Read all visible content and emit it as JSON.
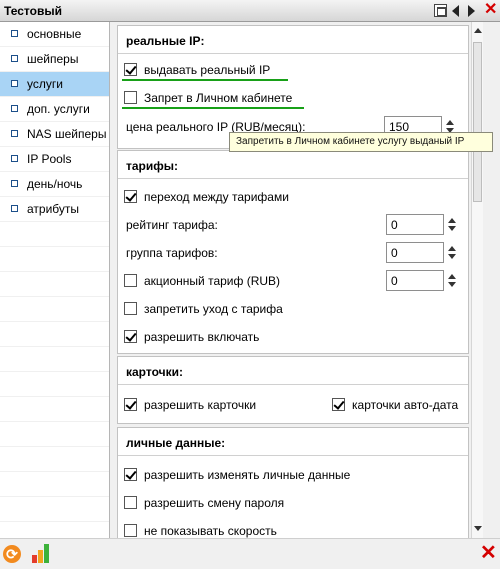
{
  "window": {
    "title": "Тестовый"
  },
  "sidebar": {
    "items": [
      {
        "label": "основные"
      },
      {
        "label": "шейперы"
      },
      {
        "label": "услуги"
      },
      {
        "label": "доп. услуги"
      },
      {
        "label": "NAS шейперы"
      },
      {
        "label": "IP Pools"
      },
      {
        "label": "день/ночь"
      },
      {
        "label": "атрибуты"
      }
    ],
    "active_index": 2
  },
  "sections": {
    "real_ip": {
      "title": "реальные IP:",
      "give_real_ip": {
        "label": "выдавать реальный IP",
        "checked": true
      },
      "deny_in_cabinet": {
        "label": "Запрет в Личном кабинете",
        "checked": false
      },
      "price": {
        "label": "цена реального IP (RUB/месяц):",
        "value": "150"
      }
    },
    "tariffs": {
      "title": "тарифы:",
      "switch_between": {
        "label": "переход между тарифами",
        "checked": true
      },
      "rating": {
        "label": "рейтинг тарифа:",
        "value": "0"
      },
      "group": {
        "label": "группа тарифов:",
        "value": "0"
      },
      "promo": {
        "label": "акционный тариф (RUB)",
        "checked": false,
        "value": "0"
      },
      "deny_leave": {
        "label": "запретить уход с тарифа",
        "checked": false
      },
      "allow_enable": {
        "label": "разрешить включать",
        "checked": true
      }
    },
    "cards": {
      "title": "карточки:",
      "allow_cards": {
        "label": "разрешить карточки",
        "checked": true
      },
      "cards_auto_date": {
        "label": "карточки авто-дата",
        "checked": true
      }
    },
    "personal": {
      "title": "личные данные:",
      "allow_edit": {
        "label": "разрешить изменять личные данные",
        "checked": true
      },
      "allow_password": {
        "label": "разрешить смену пароля",
        "checked": false
      },
      "hide_speed": {
        "label": "не показывать скорость",
        "checked": false
      }
    }
  },
  "tooltip": {
    "text": "Запретить в Личном кабинете услугу выданый IP"
  },
  "colors": {
    "active_item": "#a9d4f5",
    "highlight_line": "#18a018",
    "close_red": "#d40000"
  }
}
